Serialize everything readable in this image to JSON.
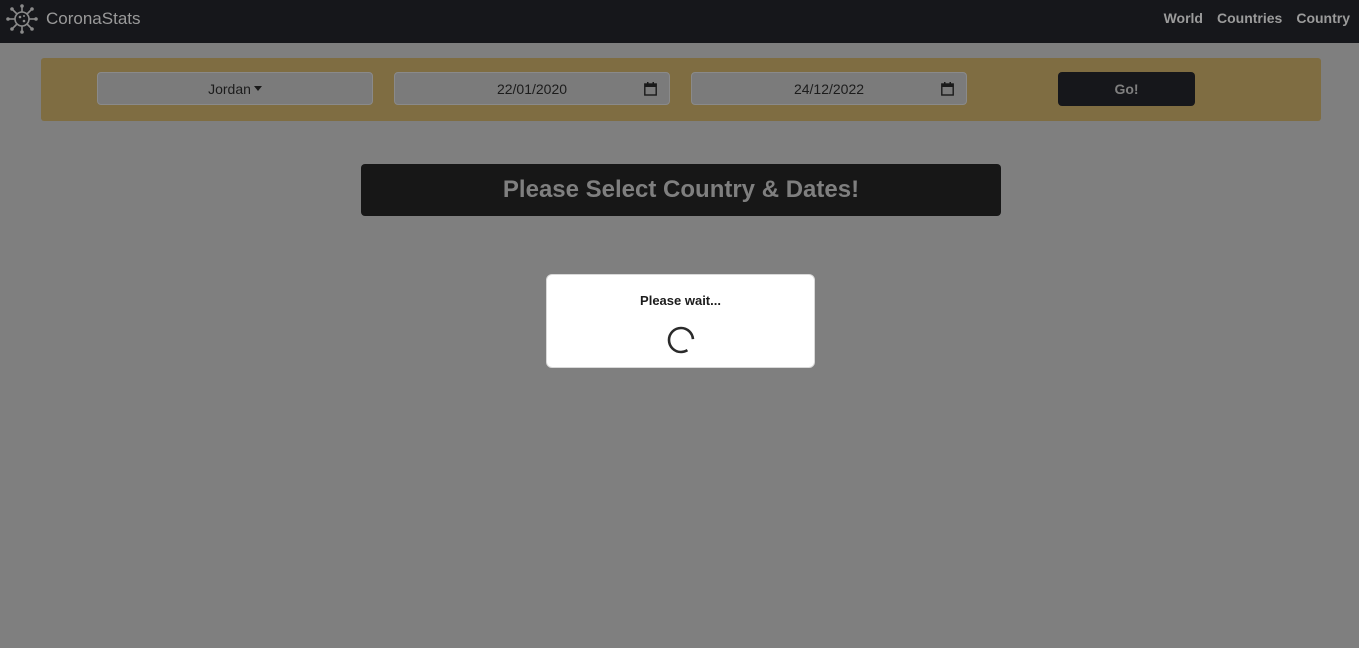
{
  "navbar": {
    "brand": "CoronaStats",
    "links": [
      "World",
      "Countries",
      "Country"
    ]
  },
  "filters": {
    "country": "Jordan",
    "date_from": "22/01/2020",
    "date_to": "24/12/2022",
    "go_label": "Go!"
  },
  "headline": "Please Select Country & Dates!",
  "modal": {
    "message": "Please wait..."
  },
  "colors": {
    "navbar": "#16171b",
    "filter_bar": "#7f6d42",
    "overlay_gray": "#7f7f7f"
  },
  "icons": {
    "brand": "virus-icon",
    "calendar": "calendar-icon",
    "loading": "spinner-icon"
  }
}
